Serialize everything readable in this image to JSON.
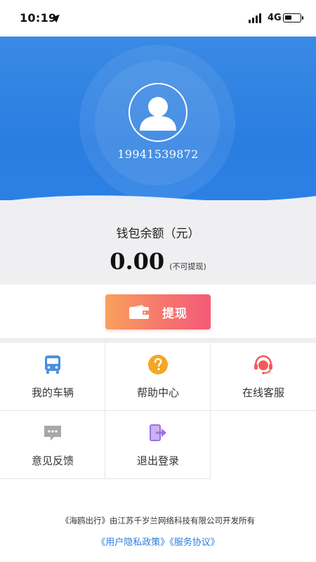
{
  "status_bar": {
    "time": "10:19",
    "network": "4G",
    "icons": [
      "location-arrow-icon",
      "signal-icon",
      "battery-icon"
    ]
  },
  "profile": {
    "phone": "19941539872",
    "avatar_icon": "user-avatar-icon"
  },
  "wallet": {
    "label": "钱包余额（元）",
    "amount": "0.00",
    "note": "(不可提现)"
  },
  "withdraw": {
    "label": "提现",
    "icon": "wallet-icon"
  },
  "menu": {
    "items": [
      {
        "label": "我的车辆",
        "icon": "bus-icon",
        "color": "#4a90e2"
      },
      {
        "label": "帮助中心",
        "icon": "question-icon",
        "color": "#f5a623"
      },
      {
        "label": "在线客服",
        "icon": "customer-service-icon",
        "color": "#f25a5a"
      },
      {
        "label": "意见反馈",
        "icon": "feedback-icon",
        "color": "#9b9b9b"
      },
      {
        "label": "退出登录",
        "icon": "logout-icon",
        "color": "#9d6fe0"
      }
    ]
  },
  "footer": {
    "copyright": "《海鸥出行》由江苏千岁兰网络科技有限公司开发所有",
    "privacy_link": "《用户隐私政策》",
    "service_link": "《服务协议》"
  },
  "colors": {
    "header_blue": "#2a7de1",
    "wallet_bg": "#efeff1",
    "button_gradient_start": "#f9a05c",
    "button_gradient_end": "#f45a78",
    "link_blue": "#2a7de1"
  }
}
